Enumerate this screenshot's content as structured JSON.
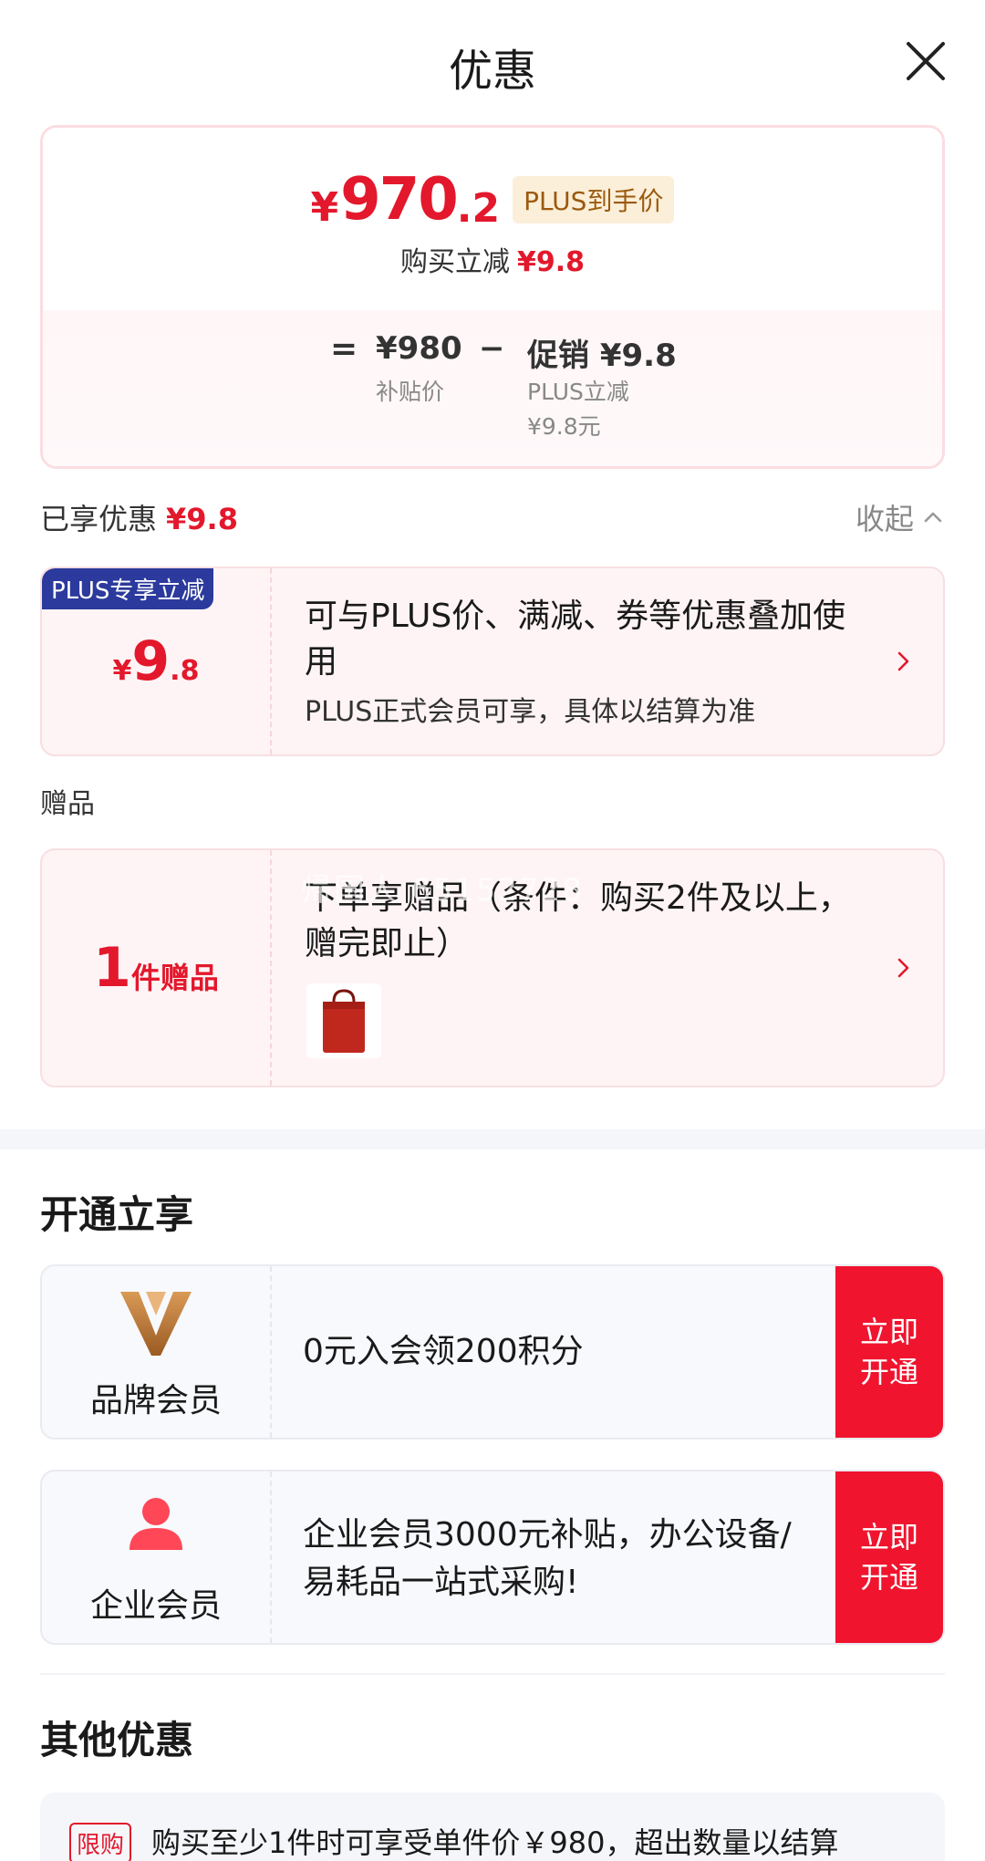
{
  "header": {
    "title": "优惠"
  },
  "price_card": {
    "currency": "¥",
    "price_int": "970",
    "price_dec": ".2",
    "plus_tag": "PLUS到手价",
    "reduce_label": "购买立减",
    "reduce_value": "¥9.8",
    "eq": "=",
    "base_value": "¥980",
    "base_label": "补贴价",
    "minus": "−",
    "promo_value": "促销 ¥9.8",
    "promo_label": "PLUS立减",
    "promo_sub": "¥9.8元"
  },
  "enjoyed": {
    "label": "已享优惠",
    "value": "¥9.8",
    "collapse": "收起"
  },
  "plus_coupon": {
    "corner": "PLUS专享立减",
    "currency": "¥",
    "amt_int": "9",
    "amt_dec": ".8",
    "title": "可与PLUS价、满减、券等优惠叠加使用",
    "subtitle": "PLUS正式会员可享，具体以结算为准"
  },
  "gift_section": {
    "label": "赠品"
  },
  "gift_coupon": {
    "count": "1",
    "word": "件赠品",
    "title": "下单享赠品（条件：购买2件及以上，赠完即止）",
    "watermark": "帰国人 65152728"
  },
  "open_section": {
    "title": "开通立享"
  },
  "brand_member": {
    "name": "品牌会员",
    "desc": "0元入会领200积分",
    "btn": "立即开通"
  },
  "enterprise_member": {
    "name": "企业会员",
    "desc": " 企业会员3000元补贴，办公设备/易耗品一站式采购!",
    "btn": "立即开通"
  },
  "other_section": {
    "title": "其他优惠"
  },
  "limit_offer": {
    "tag": "限购",
    "text": "购买至少1件时可享受单件价￥980，超出数量以结算"
  },
  "colors": {
    "accent": "#e3182c",
    "plus_blue": "#2b3a9c",
    "button_red": "#f0142e"
  },
  "icons": [
    "close-icon",
    "chevron-up-icon",
    "chevron-right-icon",
    "brand-v-logo-icon",
    "person-icon",
    "gift-bag-image"
  ]
}
